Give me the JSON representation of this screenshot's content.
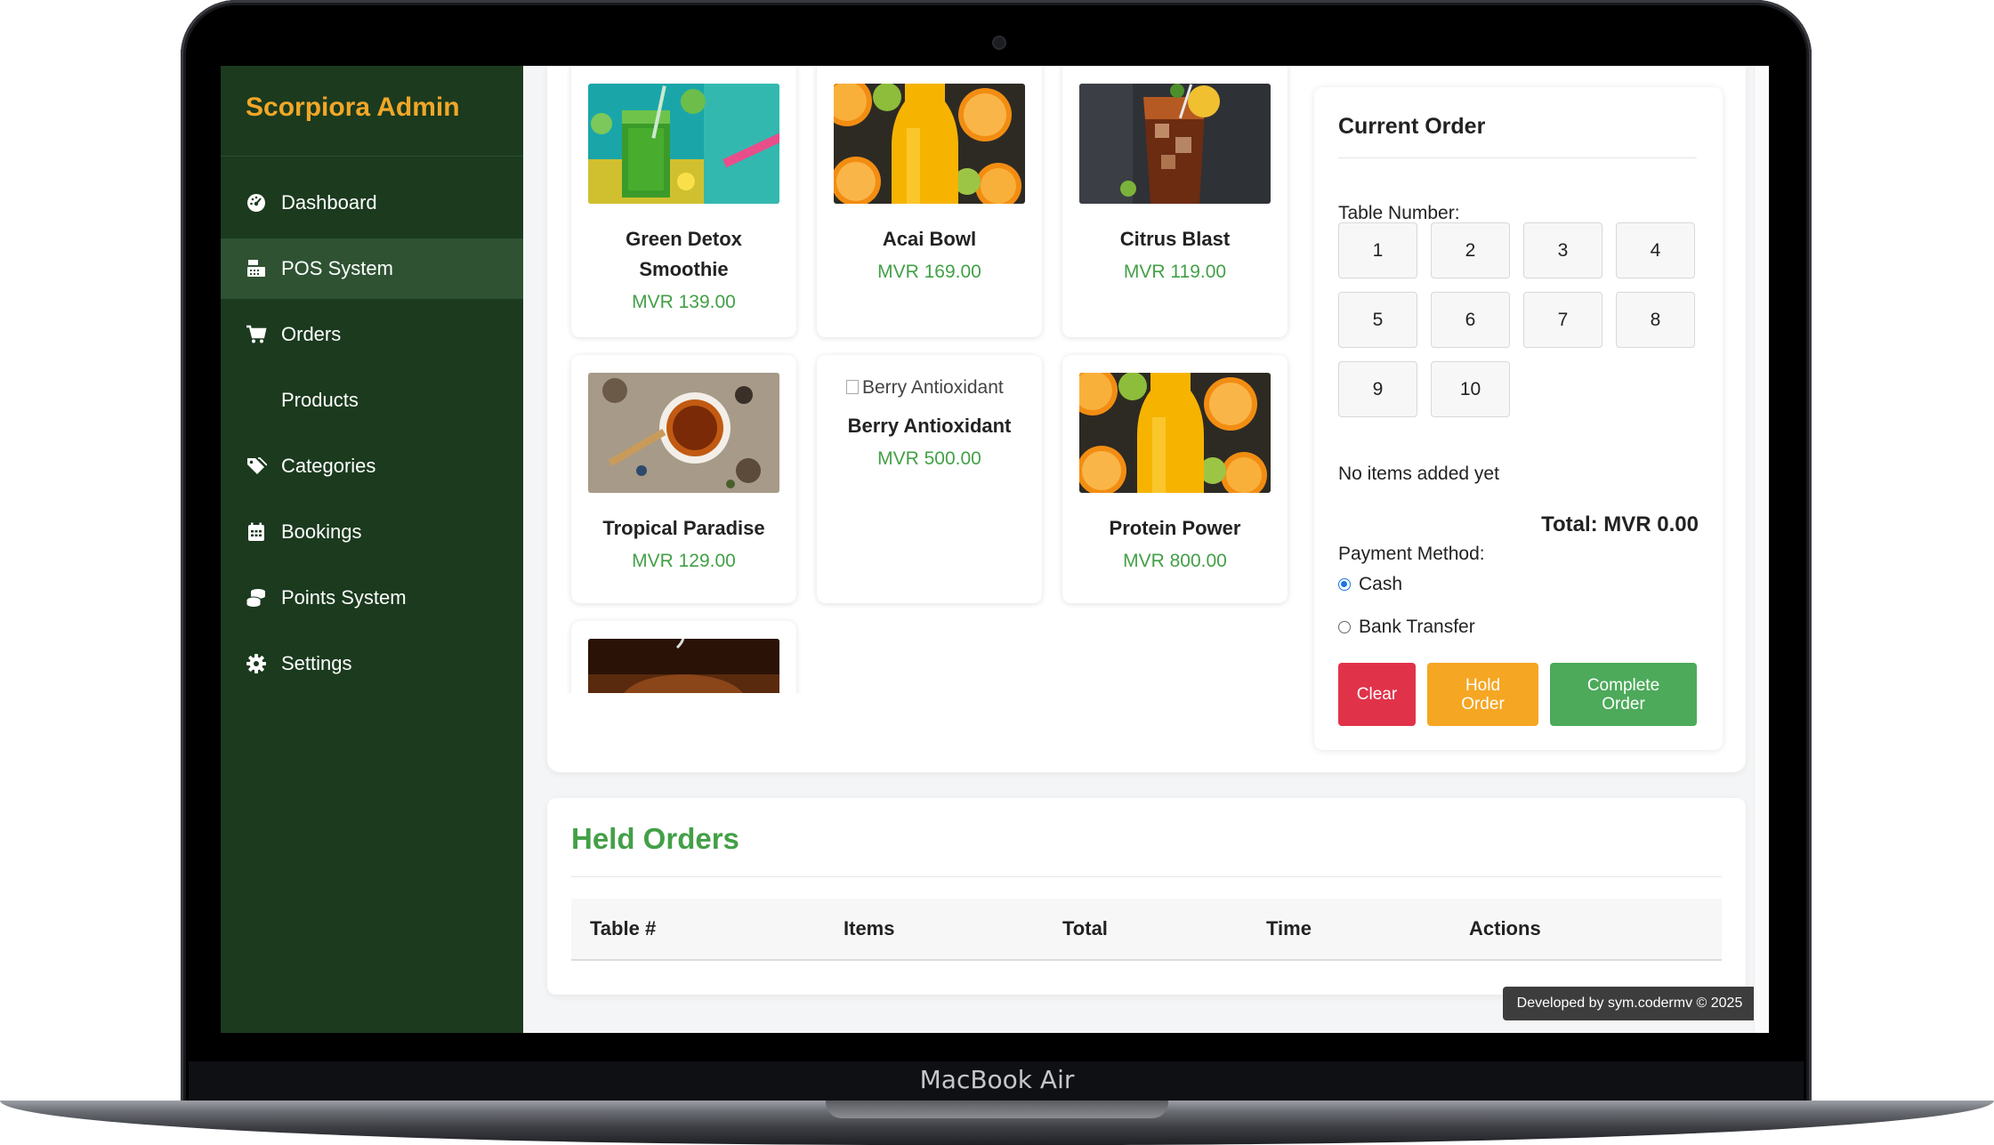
{
  "device": {
    "label": "MacBook Air"
  },
  "sidebar": {
    "brand": "Scorpiora Admin",
    "items": [
      {
        "label": "Dashboard",
        "icon": "dashboard-icon"
      },
      {
        "label": "POS System",
        "icon": "cash-register-icon",
        "active": true
      },
      {
        "label": "Orders",
        "icon": "cart-icon"
      },
      {
        "label": "Products",
        "icon": ""
      },
      {
        "label": "Categories",
        "icon": "tags-icon"
      },
      {
        "label": "Bookings",
        "icon": "calendar-icon"
      },
      {
        "label": "Points System",
        "icon": "coins-icon"
      },
      {
        "label": "Settings",
        "icon": "gear-icon"
      }
    ]
  },
  "products": [
    {
      "name": "Green Detox Smoothie",
      "price": "MVR 139.00",
      "image": "green-smoothie-photo"
    },
    {
      "name": "Acai Bowl",
      "price": "MVR 169.00",
      "image": "orange-juice-photo"
    },
    {
      "name": "Citrus Blast",
      "price": "MVR 119.00",
      "image": "iced-drink-photo"
    },
    {
      "name": "Tropical Paradise",
      "price": "MVR 129.00",
      "image": "tea-photo"
    },
    {
      "name": "Berry Antioxidant",
      "price": "MVR 500.00",
      "image_alt": "Berry Antioxidant"
    },
    {
      "name": "Protein Power",
      "price": "MVR 800.00",
      "image": "orange-juice-photo"
    }
  ],
  "order": {
    "title": "Current Order",
    "table_label": "Table Number:",
    "tables": [
      "1",
      "2",
      "3",
      "4",
      "5",
      "6",
      "7",
      "8",
      "9",
      "10"
    ],
    "empty_text": "No items added yet",
    "total": "Total: MVR 0.00",
    "payment_label": "Payment Method:",
    "payment_options": [
      {
        "label": "Cash",
        "selected": true
      },
      {
        "label": "Bank Transfer",
        "selected": false
      }
    ],
    "buttons": {
      "clear": "Clear",
      "hold": "Hold Order",
      "complete": "Complete Order"
    },
    "colors": {
      "clear": "#e0334a",
      "hold": "#f5a623",
      "complete": "#4caa5a"
    }
  },
  "held_orders": {
    "title": "Held Orders",
    "columns": [
      "Table #",
      "Items",
      "Total",
      "Time",
      "Actions"
    ]
  },
  "footer": {
    "credit": "Developed by sym.codermv © 2025"
  },
  "colors": {
    "sidebar": "#1b3a1e",
    "brand": "#f2a727",
    "price": "#43a047"
  }
}
